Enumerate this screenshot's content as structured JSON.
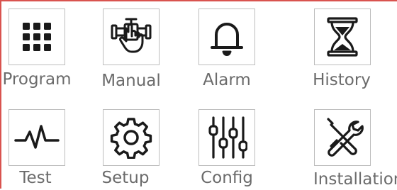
{
  "menu": {
    "items": [
      {
        "id": "program",
        "label": "Program",
        "icon": "grid-icon"
      },
      {
        "id": "manual",
        "label": "Manual",
        "icon": "valve-hand-icon"
      },
      {
        "id": "alarm",
        "label": "Alarm",
        "icon": "bell-icon"
      },
      {
        "id": "history",
        "label": "History",
        "icon": "hourglass-icon"
      },
      {
        "id": "test",
        "label": "Test",
        "icon": "pulse-icon"
      },
      {
        "id": "setup",
        "label": "Setup",
        "icon": "gear-icon"
      },
      {
        "id": "config",
        "label": "Config",
        "icon": "sliders-icon"
      },
      {
        "id": "installation",
        "label": "Installation",
        "icon": "tools-icon"
      }
    ]
  },
  "colors": {
    "frame": "#d9534f",
    "icon": "#1a1a1a",
    "label": "#6b6b6b",
    "tile_border": "#bdbdbd"
  }
}
